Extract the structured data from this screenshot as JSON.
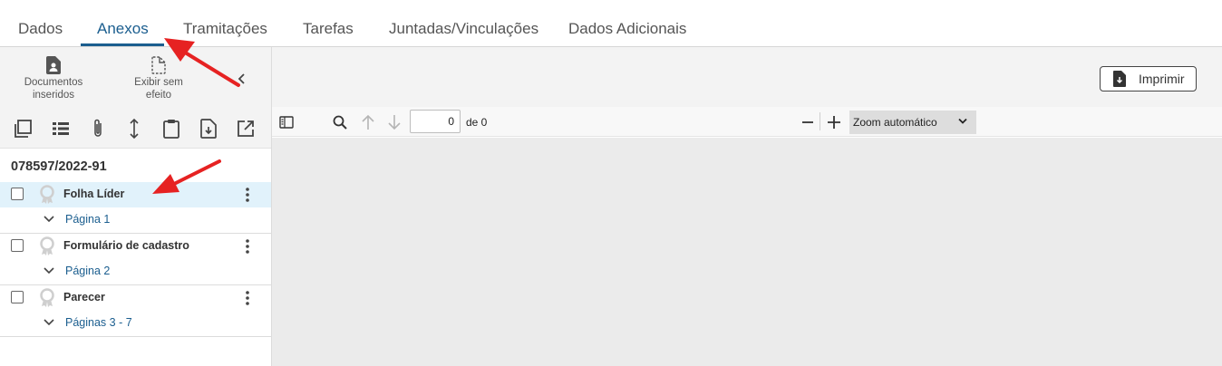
{
  "tabs": [
    {
      "label": "Dados",
      "active": false
    },
    {
      "label": "Anexos",
      "active": true
    },
    {
      "label": "Tramitações",
      "active": false
    },
    {
      "label": "Tarefas",
      "active": false
    },
    {
      "label": "Juntadas/Vinculações",
      "active": false
    },
    {
      "label": "Dados Adicionais",
      "active": false
    }
  ],
  "toolbar": {
    "documentos_inseridos": "Documentos inseridos",
    "exibir_sem_efeito": "Exibir sem efeito",
    "collapse_icon": "chevron-left-icon"
  },
  "icon_row": [
    "copy-icon",
    "list-icon",
    "paperclip-icon",
    "vertical-arrows-icon",
    "clipboard-icon",
    "file-download-icon",
    "external-link-icon"
  ],
  "process_number": "078597/2022-91",
  "documents": [
    {
      "title": "Folha Líder",
      "pages": "Página 1",
      "selected": true
    },
    {
      "title": "Formulário de cadastro",
      "pages": "Página 2",
      "selected": false
    },
    {
      "title": "Parecer",
      "pages": "Páginas 3 - 7",
      "selected": false
    }
  ],
  "print_button": {
    "label": "Imprimir",
    "icon": "file-download-icon"
  },
  "viewer": {
    "page_value": "0",
    "page_of": "de 0",
    "zoom": "Zoom automático"
  },
  "colors": {
    "accent": "#1b5e8f",
    "selected_row": "#e1f2fb",
    "annotation_arrow": "#e62222"
  }
}
